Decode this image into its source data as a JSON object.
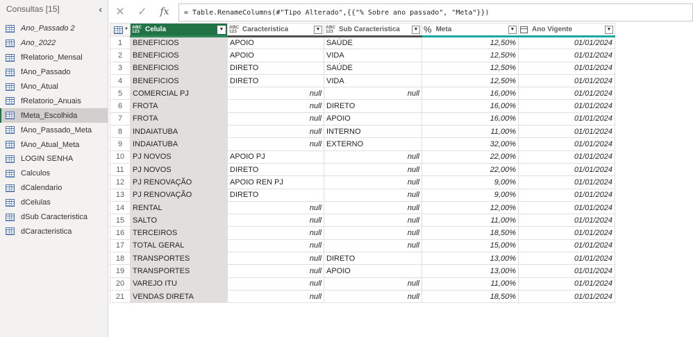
{
  "queries": {
    "title": "Consultas [15]",
    "collapse_glyph": "‹",
    "items": [
      {
        "label": "Ano_Passado 2",
        "italic": true
      },
      {
        "label": "Ano_2022",
        "italic": true
      },
      {
        "label": "fRelatorio_Mensal",
        "italic": false
      },
      {
        "label": "fAno_Passado",
        "italic": false
      },
      {
        "label": "fAno_Atual",
        "italic": false
      },
      {
        "label": "fRelatorio_Anuais",
        "italic": false
      },
      {
        "label": "fMeta_Escolhida",
        "italic": false,
        "selected": true
      },
      {
        "label": "fAno_Passado_Meta",
        "italic": false
      },
      {
        "label": "fAno_Atual_Meta",
        "italic": false
      },
      {
        "label": "LOGIN SENHA",
        "italic": false
      },
      {
        "label": "Calculos",
        "italic": false
      },
      {
        "label": "dCalendario",
        "italic": false
      },
      {
        "label": "dCelulas",
        "italic": false
      },
      {
        "label": "dSub Caracteristica",
        "italic": false
      },
      {
        "label": "dCaracteristica",
        "italic": false
      }
    ]
  },
  "formula_bar": {
    "cancel_glyph": "✕",
    "confirm_glyph": "✓",
    "fx_label": "fx",
    "formula": "= Table.RenameColumns(#\"Tipo Alterado\",{{\"% Sobre ano passado\", \"Meta\"}})"
  },
  "grid": {
    "type_abc": "ABC",
    "type_123": "123",
    "type_pct": "%",
    "dropdown_glyph": "▼",
    "columns": [
      "Celula",
      "Caracteristica",
      "Sub Caracteristica",
      "Meta",
      "Ano Vigente"
    ],
    "rows": [
      [
        "1",
        "BENEFICIOS",
        "APOIO",
        "SAÚDE",
        "12,50%",
        "01/01/2024"
      ],
      [
        "2",
        "BENEFICIOS",
        "APOIO",
        "VIDA",
        "12,50%",
        "01/01/2024"
      ],
      [
        "3",
        "BENEFICIOS",
        "DIRETO",
        "SAÚDE",
        "12,50%",
        "01/01/2024"
      ],
      [
        "4",
        "BENEFICIOS",
        "DIRETO",
        "VIDA",
        "12,50%",
        "01/01/2024"
      ],
      [
        "5",
        "COMERCIAL PJ",
        "null",
        "null",
        "16,00%",
        "01/01/2024"
      ],
      [
        "6",
        "FROTA",
        "null",
        "DIRETO",
        "16,00%",
        "01/01/2024"
      ],
      [
        "7",
        "FROTA",
        "null",
        "APOIO",
        "16,00%",
        "01/01/2024"
      ],
      [
        "8",
        "INDAIATUBA",
        "null",
        "INTERNO",
        "11,00%",
        "01/01/2024"
      ],
      [
        "9",
        "INDAIATUBA",
        "null",
        "EXTERNO",
        "32,00%",
        "01/01/2024"
      ],
      [
        "10",
        "PJ NOVOS",
        "APOIO PJ",
        "null",
        "22,00%",
        "01/01/2024"
      ],
      [
        "11",
        "PJ NOVOS",
        "DIRETO",
        "null",
        "22,00%",
        "01/01/2024"
      ],
      [
        "12",
        "PJ RENOVAÇÃO",
        "APOIO REN PJ",
        "null",
        "9,00%",
        "01/01/2024"
      ],
      [
        "13",
        "PJ RENOVAÇÃO",
        "DIRETO",
        "null",
        "9,00%",
        "01/01/2024"
      ],
      [
        "14",
        "RENTAL",
        "null",
        "null",
        "12,00%",
        "01/01/2024"
      ],
      [
        "15",
        "SALTO",
        "null",
        "null",
        "11,00%",
        "01/01/2024"
      ],
      [
        "16",
        "TERCEIROS",
        "null",
        "null",
        "18,50%",
        "01/01/2024"
      ],
      [
        "17",
        "TOTAL GERAL",
        "null",
        "null",
        "15,00%",
        "01/01/2024"
      ],
      [
        "18",
        "TRANSPORTES",
        "null",
        "DIRETO",
        "13,00%",
        "01/01/2024"
      ],
      [
        "19",
        "TRANSPORTES",
        "null",
        "APOIO",
        "13,00%",
        "01/01/2024"
      ],
      [
        "20",
        "VAREJO ITU",
        "null",
        "null",
        "11,00%",
        "01/01/2024"
      ],
      [
        "21",
        "VENDAS DIRETA",
        "null",
        "null",
        "18,50%",
        "01/01/2024"
      ]
    ]
  },
  "colors": {
    "selected_header": "#217346",
    "quality_bar": "#1aa9a0",
    "selected_column_cells": "#e1dfdd"
  }
}
